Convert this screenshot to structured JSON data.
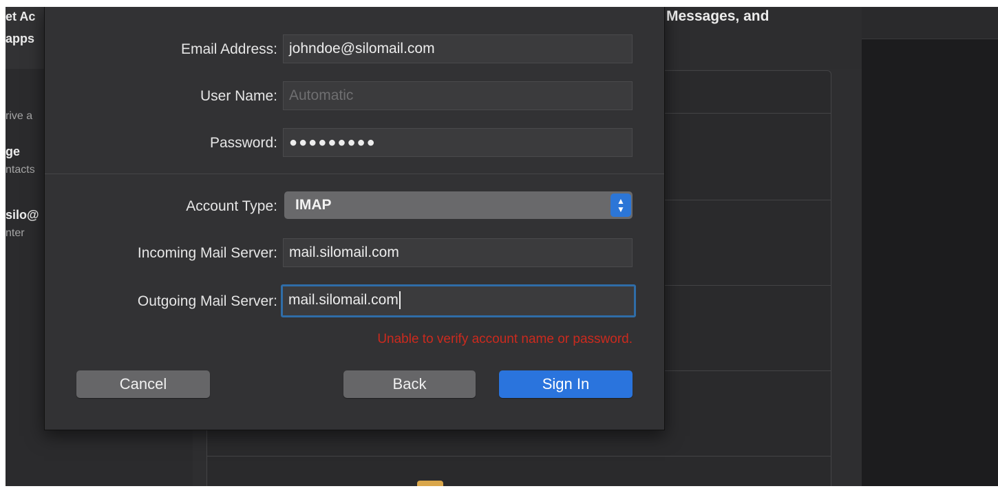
{
  "background": {
    "sidebar_fragments": [
      "et Ac",
      "apps",
      "rive a",
      "ge",
      "ntacts",
      "silo@",
      "nter"
    ],
    "header_fragment": "Messages, and"
  },
  "dialog": {
    "fields": {
      "email": {
        "label": "Email Address:",
        "value": "johndoe@silomail.com"
      },
      "username": {
        "label": "User Name:",
        "placeholder": "Automatic"
      },
      "password": {
        "label": "Password:",
        "value": "●●●●●●●●●"
      },
      "account_type": {
        "label": "Account Type:",
        "value": "IMAP"
      },
      "incoming": {
        "label": "Incoming Mail Server:",
        "value": "mail.silomail.com"
      },
      "outgoing": {
        "label": "Outgoing Mail Server:",
        "value": "mail.silomail.com"
      }
    },
    "error_message": "Unable to verify account name or password.",
    "buttons": {
      "cancel": "Cancel",
      "back": "Back",
      "sign_in": "Sign In"
    }
  },
  "colors": {
    "accent": "#2a74dd",
    "error": "#cc2a1e",
    "focus_ring": "#2f6da8"
  }
}
